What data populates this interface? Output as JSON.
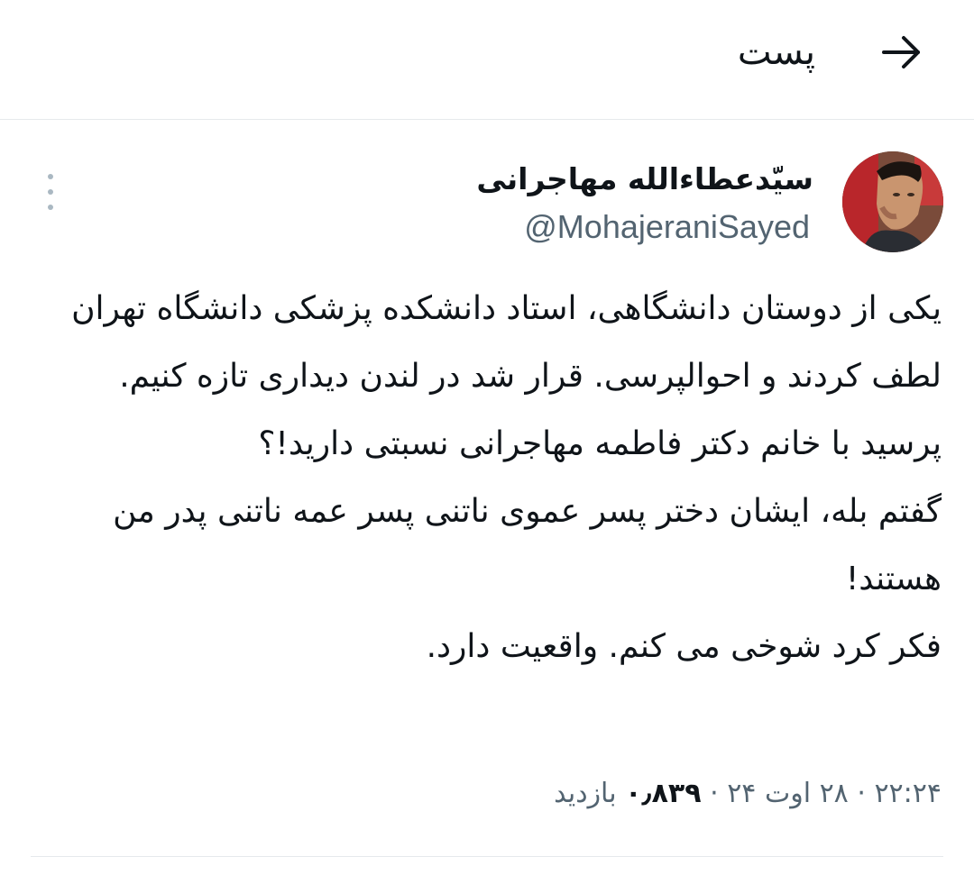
{
  "header": {
    "title": "پست",
    "back_icon": "arrow-right-icon"
  },
  "tweet": {
    "author": {
      "display_name": "سیّدعطاءالله مهاجرانی",
      "handle": "@MohajeraniSayed"
    },
    "body_lines": [
      "یکی از دوستان دانشگاهی، استاد دانشکده پزشکی دانشگاه تهران لطف کردند و احوالپرسی. قرار شد در لندن دیداری تازه کنیم. پرسید با خانم دکتر فاطمه مهاجرانی نسبتی دارید!؟",
      "گفتم بله، ایشان دختر پسر عموی ناتنی پسر عمه ناتنی پدر من هستند!",
      "فکر کرد شوخی می کنم. واقعیت دارد."
    ],
    "meta": {
      "time": "۲۲:۲۴",
      "separator": "·",
      "date": "۲۸ اوت ۲۴",
      "views_count": "۰٫۸۳۹",
      "views_label": "بازدید"
    }
  },
  "colors": {
    "text_primary": "#0f1419",
    "text_secondary": "#536471",
    "divider": "#e6e9ec"
  }
}
